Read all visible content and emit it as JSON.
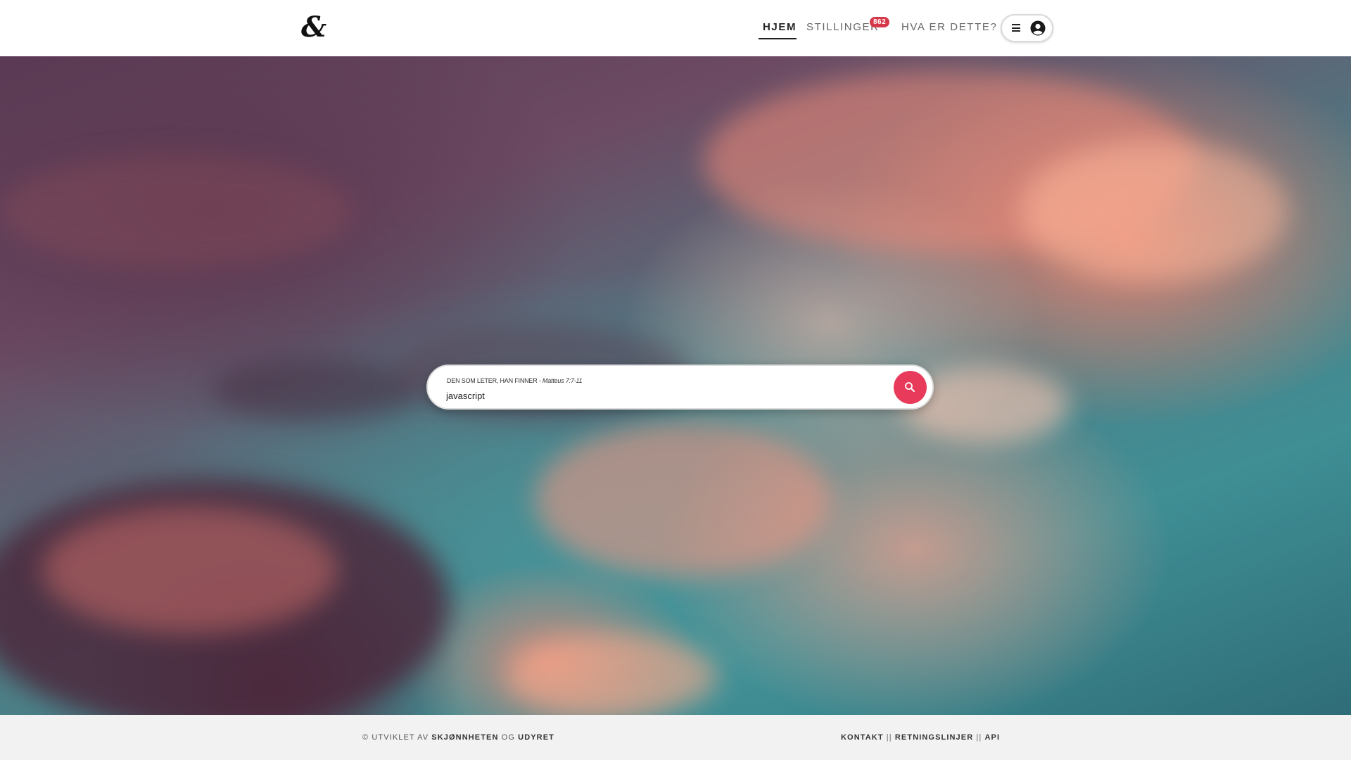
{
  "header": {
    "logo_text": "&",
    "nav": [
      {
        "label": "HJEM",
        "active": true
      },
      {
        "label": "STILLINGER",
        "badge": "862"
      },
      {
        "label": "HVA ER DETTE?"
      }
    ]
  },
  "search": {
    "hint_prefix": "DEN SOM LETER, HAN FINNER - ",
    "hint_ref": "Matteus 7:7-11",
    "value": "javascript",
    "button_icon": "search-icon"
  },
  "footer": {
    "copyright_prefix": "© UTVIKLET AV ",
    "author_a": "SKJØNNHETEN",
    "joiner": " OG ",
    "author_b": "UDYRET",
    "links": [
      "KONTAKT",
      "RETNINGSLINJER",
      "API"
    ],
    "separator": " || "
  },
  "colors": {
    "accent": "#e83a5a",
    "badge": "#d6384a",
    "footer_bg": "#f2f2f2"
  }
}
